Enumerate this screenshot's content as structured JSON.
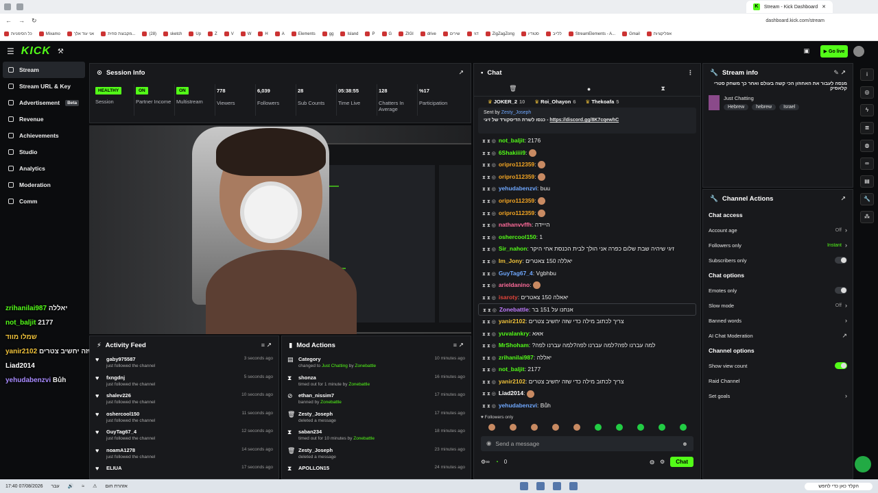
{
  "browser": {
    "tab_title": "Stream - Kick Dashboard",
    "url": "dashboard.kick.com/stream",
    "bookmarks": [
      "כל הסימניות",
      "Mixamo",
      "אני עוד אלך",
      "מקבוצת סחית...",
      "(28)",
      "sketch",
      "Up",
      "Z",
      "V",
      "W",
      "H",
      "A",
      "Elements",
      "gg",
      "Island",
      "P",
      "G",
      "ZIGI",
      "drive",
      "שירים",
      "דגי",
      "ZigZagZong",
      "סטודיו",
      "ללייב",
      "StreamElements - A...",
      "Gmail",
      "אפליקציות"
    ]
  },
  "topnav": {
    "logo": "KICK",
    "go_live": "Go live"
  },
  "sidebar": {
    "items": [
      {
        "label": "Stream",
        "active": true
      },
      {
        "label": "Stream URL & Key"
      },
      {
        "label": "Advertisement",
        "badge": "Beta"
      },
      {
        "label": "Revenue"
      },
      {
        "label": "Achievements"
      },
      {
        "label": "Studio"
      },
      {
        "label": "Analytics"
      },
      {
        "label": "Moderation"
      },
      {
        "label": "Comm"
      }
    ]
  },
  "session": {
    "title": "Session Info",
    "stats": [
      {
        "value": "HEALTHY",
        "label": "Session",
        "badge": true
      },
      {
        "value": "ON",
        "label": "Partner Income",
        "badge": true
      },
      {
        "value": "ON",
        "label": "Multistream",
        "badge": true
      },
      {
        "value": "778",
        "label": "Viewers"
      },
      {
        "value": "6,039",
        "label": "Followers"
      },
      {
        "value": "28",
        "label": "Sub Counts"
      },
      {
        "value": "05:38:55",
        "label": "Time Live"
      },
      {
        "value": "128",
        "label": "Chatters In Average"
      },
      {
        "value": "%17",
        "label": "Participation"
      }
    ]
  },
  "overlay_chat": [
    {
      "user": "zrihanilai987",
      "text": "יאללה",
      "color": "#53fc18"
    },
    {
      "user": "not_baljit",
      "text": "2177",
      "color": "#53fc18"
    },
    {
      "user": "שמלו מווד",
      "text": "",
      "color": "#f0c23a"
    },
    {
      "user": "yanir2102",
      "text": "לכתוב מילה כדי שזה יחשיב צטרמצריך לכתוב מילה כדי שזה יחשיב צטרים",
      "color": "#f0c23a"
    },
    {
      "user": "Liad2014",
      "text": "",
      "color": "#ffffff"
    },
    {
      "user": "yehudabenzvi",
      "text": "Bůh",
      "color": "#a88bff"
    }
  ],
  "activity": {
    "title": "Activity Feed",
    "items": [
      {
        "user": "gaby975587",
        "sub": "just followed the channel",
        "time": "3 seconds ago"
      },
      {
        "user": "fxngdnj",
        "sub": "just followed the channel",
        "time": "5 seconds ago"
      },
      {
        "user": "shalev226",
        "sub": "just followed the channel",
        "time": "10 seconds ago"
      },
      {
        "user": "oshercool150",
        "sub": "just followed the channel",
        "time": "11 seconds ago"
      },
      {
        "user": "GuyTag67_4",
        "sub": "just followed the channel",
        "time": "12 seconds ago"
      },
      {
        "user": "noamA1278",
        "sub": "just followed the channel",
        "time": "14 seconds ago"
      },
      {
        "user": "ELIUA",
        "sub": "",
        "time": "17 seconds ago"
      }
    ]
  },
  "mod": {
    "title": "Mod Actions",
    "items": [
      {
        "icon": "▤",
        "user": "Category",
        "sub_a": "changed to ",
        "sub_g": "Just Chatting",
        "sub_b": " by ",
        "by": "Zonebattle",
        "time": "10 minutes ago"
      },
      {
        "icon": "⧗",
        "user": "shonza",
        "sub_a": "timed out for 1 minute by ",
        "sub_g": "",
        "sub_b": "",
        "by": "Zonebattle",
        "time": "16 minutes ago"
      },
      {
        "icon": "⊘",
        "user": "ethan_nissim7",
        "sub_a": "banned by ",
        "sub_g": "",
        "sub_b": "",
        "by": "Zonebattle",
        "time": "17 minutes ago"
      },
      {
        "icon": "🗑",
        "user": "Zesty_Joseph",
        "sub_a": "deleted a message",
        "sub_g": "",
        "sub_b": "",
        "by": "",
        "time": "17 minutes ago"
      },
      {
        "icon": "⧗",
        "user": "saban234",
        "sub_a": "timed out for 10 minutes by ",
        "sub_g": "",
        "sub_b": "",
        "by": "Zonebattle",
        "time": "18 minutes ago"
      },
      {
        "icon": "🗑",
        "user": "Zesty_Joseph",
        "sub_a": "deleted a message",
        "sub_g": "",
        "sub_b": "",
        "by": "",
        "time": "23 minutes ago"
      },
      {
        "icon": "⧗",
        "user": "APOLLON15",
        "sub_a": "",
        "sub_g": "",
        "sub_b": "",
        "by": "",
        "time": "24 minutes ago"
      }
    ]
  },
  "chat": {
    "title": "Chat",
    "top_users": [
      {
        "name": "JOKER_2",
        "n": "10"
      },
      {
        "name": "Roi_Ohayon",
        "n": "6"
      },
      {
        "name": "Thekoafa",
        "n": "5"
      }
    ],
    "pinned": {
      "sent_by": "Sent by",
      "author": "Zesty_Joseph",
      "text": "כנסו לשרת הדיסקורד של זיגי - ",
      "link": "https://discord.gg/8K7cqewhC"
    },
    "messages": [
      {
        "user": "not_baljit",
        "color": "#53fc18",
        "text": "2176"
      },
      {
        "user": "6Shakiiii9",
        "color": "#53fc18",
        "text": "",
        "emote": true
      },
      {
        "user": "oripro112359",
        "color": "#f5a623",
        "text": "",
        "emote": true
      },
      {
        "user": "oripro112359",
        "color": "#f5a623",
        "text": "",
        "emote": true
      },
      {
        "user": "yehudabenzvi",
        "color": "#6fa8ff",
        "text": "buu"
      },
      {
        "user": "oripro112359",
        "color": "#f5a623",
        "text": "",
        "emote": true
      },
      {
        "user": "oripro112359",
        "color": "#f5a623",
        "text": "",
        "emote": true
      },
      {
        "user": "nathanvvffh",
        "color": "#ff6b9a",
        "text": "הייידה"
      },
      {
        "user": "oshercool150",
        "color": "#53fc18",
        "text": "1"
      },
      {
        "user": "Sir_nahon",
        "color": "#53fc18",
        "text": "זיגי שיהיה שבת שלום כפרה אני הולך לבית הכנסת אחי היקר"
      },
      {
        "user": "Im_Jony",
        "color": "#f0c23a",
        "text": "יאללה 150 צאטרים"
      },
      {
        "user": "GuyTag67_4",
        "color": "#6fa8ff",
        "text": "Vgbhbu"
      },
      {
        "user": "arieldanino",
        "color": "#ff6b9a",
        "text": "",
        "emote": true
      },
      {
        "user": "isaroty",
        "color": "#e0443a",
        "text": "יאאלה 150 צאטרים"
      },
      {
        "user": "Zonebattle",
        "color": "#c07cff",
        "text": "אנחנו על 151 בר",
        "highlight": true
      },
      {
        "user": "yanir2102",
        "color": "#f0c23a",
        "text": "צריך לכתוב מילה כדי שזה יחשיב צטרים"
      },
      {
        "user": "yuvalankry",
        "color": "#53fc18",
        "text": "אאא"
      },
      {
        "user": "MrShoham",
        "color": "#53fc18",
        "text": "?למה עברנו לפה?למה עברנו לפה?למה עברנו לפה"
      },
      {
        "user": "zrihanilai987",
        "color": "#53fc18",
        "text": "יאללה"
      },
      {
        "user": "not_baljit",
        "color": "#53fc18",
        "text": "2177"
      },
      {
        "user": "yanir2102",
        "color": "#f0c23a",
        "text": "צריך לכתוב מילה כדי שזה יחשיב צטרים"
      },
      {
        "user": "Liad2014",
        "color": "#ffffff",
        "text": "",
        "emote": true
      },
      {
        "user": "yehudabenzvi",
        "color": "#6fa8ff",
        "text": "Bůh"
      }
    ],
    "followers_only": "Followers only",
    "input_placeholder": "Send a message",
    "points": "0",
    "send_label": "Chat"
  },
  "streaminfo": {
    "title": "Stream info",
    "stream_title": "מנסה לעבור את האחוזון הכי קשה בעולם ואחר כך משחק סטרי קלאסיק",
    "category": "Just Chatting",
    "tags": [
      "Hebrew",
      "hebrew",
      "Israel"
    ]
  },
  "actions": {
    "title": "Channel Actions",
    "chat_access": "Chat access",
    "account_age": "Account age",
    "account_age_val": "Off",
    "followers_only": "Followers only",
    "followers_only_val": "Instant",
    "subscribers_only": "Subscribers only",
    "chat_options": "Chat options",
    "emotes_only": "Emotes only",
    "slow_mode": "Slow mode",
    "slow_mode_val": "Off",
    "banned_words": "Banned words",
    "ai_moderation": "AI Chat Moderation",
    "channel_options": "Channel options",
    "show_view_count": "Show view count",
    "raid_channel": "Raid Channel",
    "set_goals": "Set goals"
  },
  "taskbar": {
    "time": "17:40",
    "date": "07/08/2026",
    "lang": "עבר",
    "alert": "אזהרת חום",
    "search": "הקלד כאן כדי לחפש"
  }
}
